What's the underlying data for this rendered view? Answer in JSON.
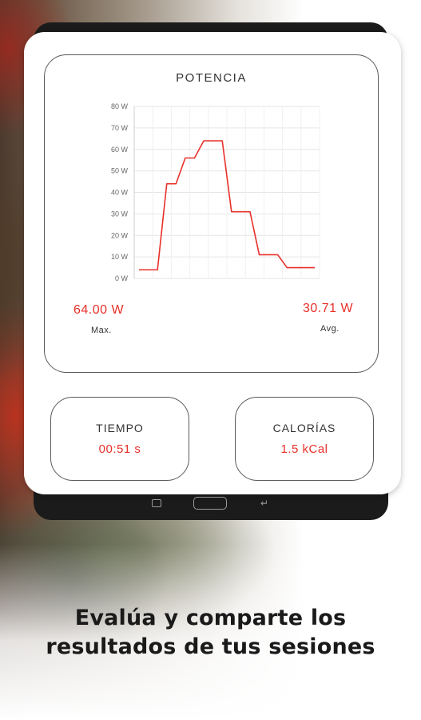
{
  "power": {
    "title": "POTENCIA",
    "max_value": "64.00 W",
    "max_label": "Max.",
    "avg_value": "30.71 W",
    "avg_label": "Avg."
  },
  "chart_data": {
    "type": "line",
    "title": "POTENCIA",
    "y_ticks": [
      "0 W",
      "10 W",
      "20 W",
      "30 W",
      "40 W",
      "50 W",
      "60 W",
      "70 W",
      "80 W"
    ],
    "ylim": [
      0,
      80
    ],
    "grid": true,
    "line_color": "#e8302a",
    "x": [
      0,
      1,
      2,
      3,
      4,
      5,
      6,
      7,
      8,
      9,
      10,
      11,
      12,
      13,
      14,
      15,
      16,
      17,
      18,
      19
    ],
    "values": [
      4,
      4,
      4,
      44,
      44,
      56,
      56,
      64,
      64,
      64,
      31,
      31,
      31,
      11,
      11,
      11,
      5,
      5,
      5,
      5
    ]
  },
  "tiempo": {
    "label": "TIEMPO",
    "value": "00:51 s"
  },
  "calorias": {
    "label": "CALORÍAS",
    "value": "1.5 kCal"
  },
  "caption": {
    "line1": "Evalúa y comparte los",
    "line2": "resultados de tus sesiones"
  },
  "icons": {
    "nav_back": "recent-apps-icon",
    "nav_home": "home-icon",
    "nav_recent": "back-icon"
  }
}
